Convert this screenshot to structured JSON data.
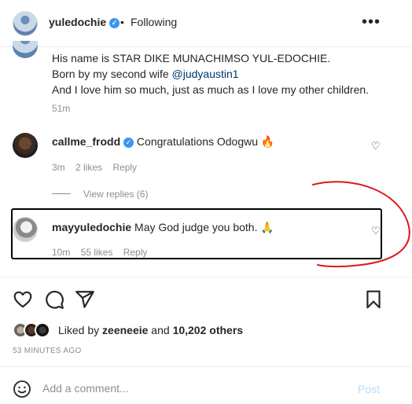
{
  "header": {
    "username": "yuledochie",
    "verified_mark": "✓",
    "separator": "•",
    "follow_status": "Following",
    "more_icon": "more-horizontal-icon"
  },
  "caption": {
    "lines": [
      "His name is STAR DIKE MUNACHIMSO YUL-EDOCHIE.",
      "Born by my second wife ",
      "And I love him so much, just as much as I love my other children."
    ],
    "mention": "@judyaustin1",
    "time": "51m"
  },
  "comments": [
    {
      "username": "callme_frodd",
      "verified": true,
      "text": "Congratulations Odogwu",
      "emoji": "🔥",
      "time": "3m",
      "likes": "2 likes",
      "reply": "Reply"
    },
    {
      "username": "mayyuledochie",
      "verified": false,
      "text": "May God judge you both.",
      "emoji": "🙏",
      "time": "10m",
      "likes": "55 likes",
      "reply": "Reply"
    }
  ],
  "view_replies": "View replies (6)",
  "actions": {
    "icons": [
      "heart-icon",
      "comment-icon",
      "share-icon",
      "bookmark-icon"
    ]
  },
  "likes": {
    "prefix": "Liked by ",
    "user": "zeeneeie",
    "middle": " and ",
    "count": "10,202 others"
  },
  "timestamp": "53 MINUTES AGO",
  "add_comment": {
    "placeholder": "Add a comment...",
    "post_label": "Post"
  },
  "colors": {
    "verified": "#3897f0",
    "post_disabled": "#b2dffc",
    "annotation_red": "#e0161b"
  }
}
